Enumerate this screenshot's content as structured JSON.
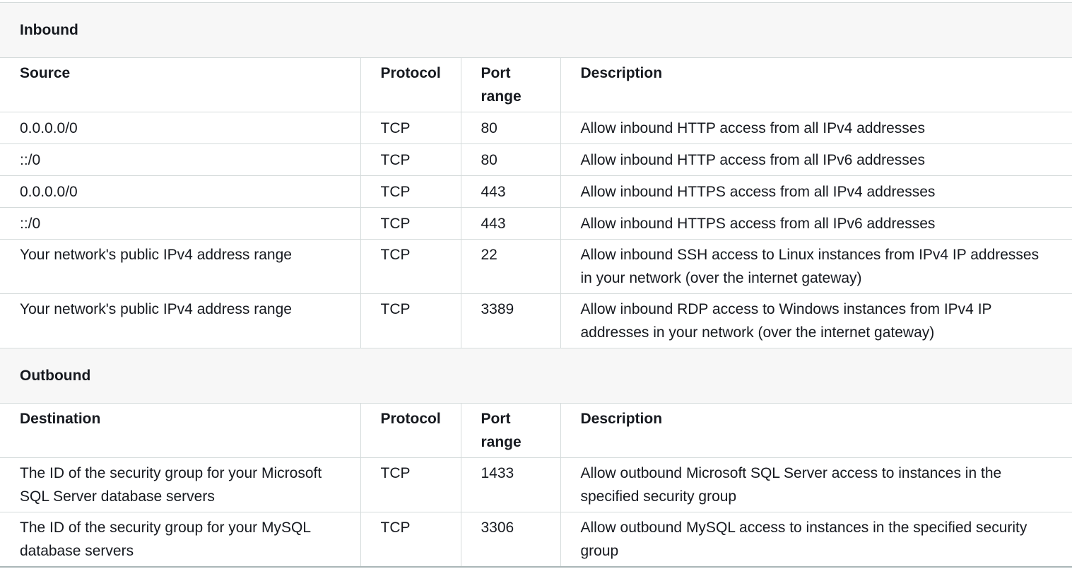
{
  "inbound": {
    "title": "Inbound",
    "headers": [
      "Source",
      "Protocol",
      "Port range",
      "Description"
    ],
    "rows": [
      {
        "endpoint": "0.0.0.0/0",
        "protocol": "TCP",
        "port": "80",
        "description": "Allow inbound HTTP access from all IPv4 addresses"
      },
      {
        "endpoint": "::/0",
        "protocol": "TCP",
        "port": "80",
        "description": "Allow inbound HTTP access from all IPv6 addresses"
      },
      {
        "endpoint": "0.0.0.0/0",
        "protocol": "TCP",
        "port": "443",
        "description": "Allow inbound HTTPS access from all IPv4 addresses"
      },
      {
        "endpoint": "::/0",
        "protocol": "TCP",
        "port": "443",
        "description": "Allow inbound HTTPS access from all IPv6 addresses"
      },
      {
        "endpoint": "Your network's public IPv4 address range",
        "protocol": "TCP",
        "port": "22",
        "description": "Allow inbound SSH access to Linux instances from IPv4 IP addresses in your network (over the internet gateway)"
      },
      {
        "endpoint": "Your network's public IPv4 address range",
        "protocol": "TCP",
        "port": "3389",
        "description": "Allow inbound RDP access to Windows instances from IPv4 IP addresses in your network (over the internet gateway)"
      }
    ]
  },
  "outbound": {
    "title": "Outbound",
    "headers": [
      "Destination",
      "Protocol",
      "Port range",
      "Description"
    ],
    "rows": [
      {
        "endpoint": "The ID of the security group for your Microsoft SQL Server database servers",
        "protocol": "TCP",
        "port": "1433",
        "description": "Allow outbound Microsoft SQL Server access to instances in the specified security group"
      },
      {
        "endpoint": "The ID of the security group for your MySQL database servers",
        "protocol": "TCP",
        "port": "3306",
        "description": "Allow outbound MySQL access to instances in the specified security group"
      }
    ]
  },
  "colors": {
    "section_background": "#f7f7f7",
    "border": "#d5dbdb",
    "text": "#16191f"
  }
}
